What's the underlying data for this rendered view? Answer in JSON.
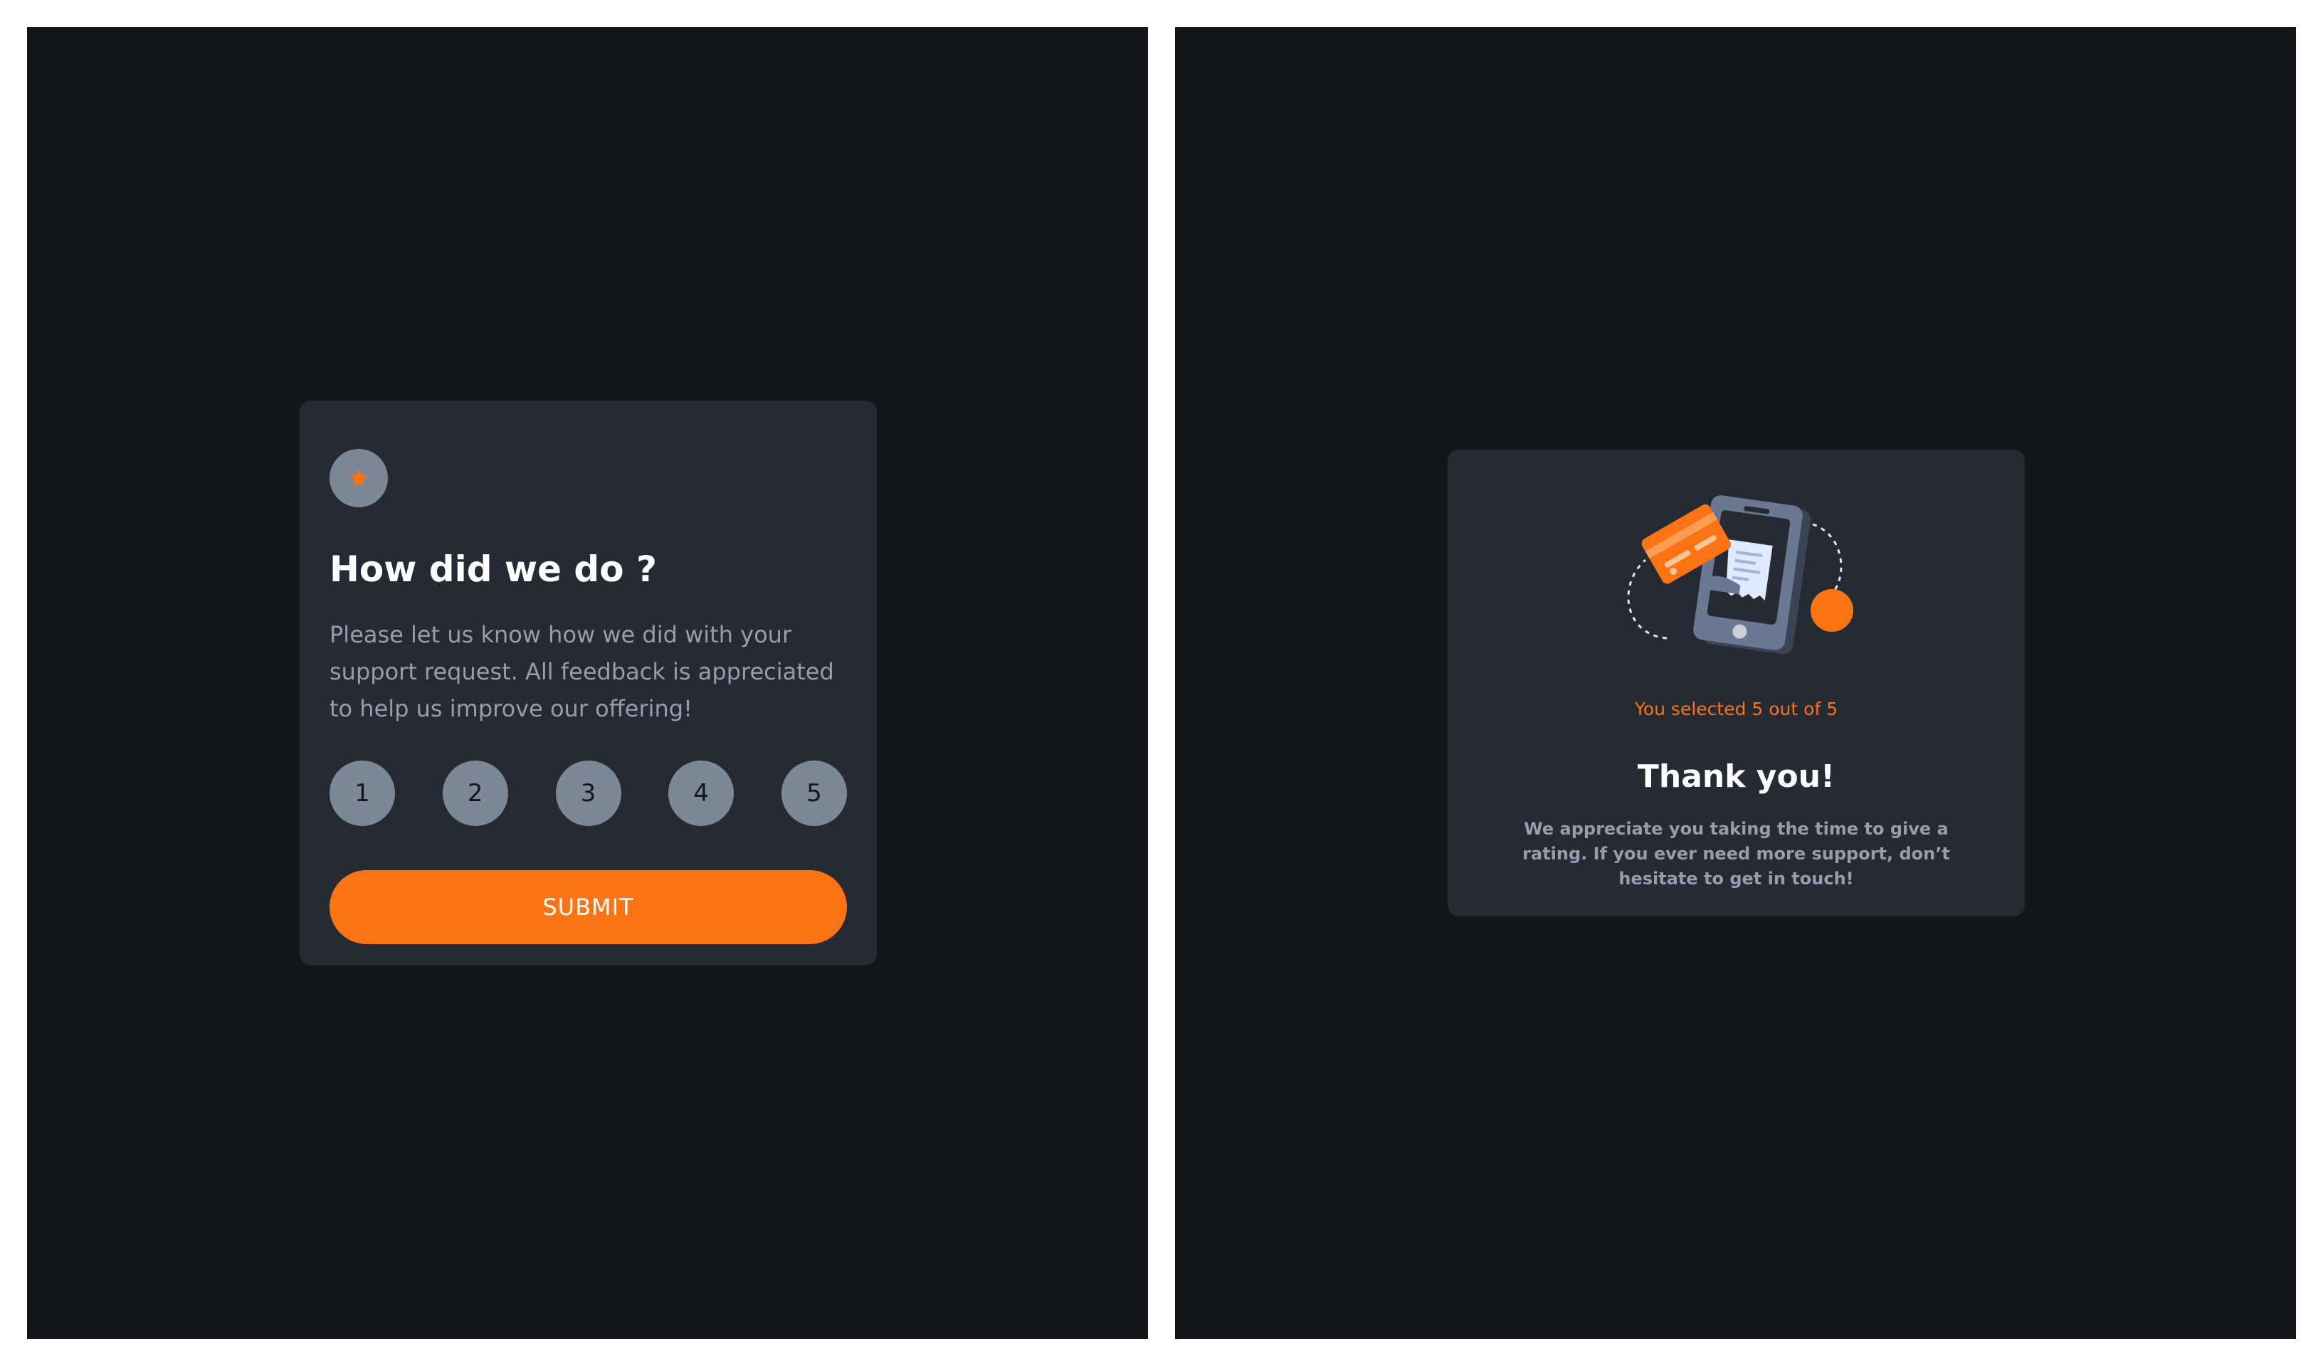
{
  "colors": {
    "page_background": "#131518",
    "card_background": "#252a33",
    "accent": "#fa7414",
    "muted_text": "#959eac",
    "rating_button": "#7c8798"
  },
  "rating_state": {
    "icon": "star-icon",
    "title": "How did we do ?",
    "description": "Please let us know how we did with your support request. All feedback is appreciated to help us improve our offering!",
    "ratings": [
      "1",
      "2",
      "3",
      "4",
      "5"
    ],
    "submit_label": "SUBMIT"
  },
  "thank_you_state": {
    "illustration": "payment-phone-illustration",
    "selected_text": "You selected 5 out of 5",
    "selected_value": 5,
    "max_value": 5,
    "title": "Thank you!",
    "description": "We appreciate you taking the time to give a rating. If you ever need more support, don’t hesitate to get in touch!"
  }
}
